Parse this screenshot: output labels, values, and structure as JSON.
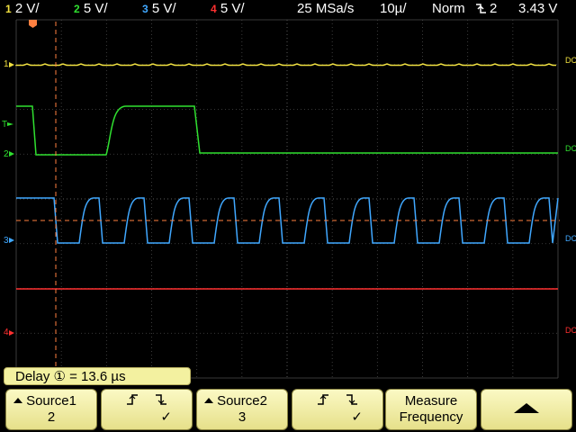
{
  "topbar": {
    "ch1": {
      "num": "1",
      "scale": "2 V/",
      "color": "#f0e040"
    },
    "ch2": {
      "num": "2",
      "scale": "5 V/",
      "color": "#30e030"
    },
    "ch3": {
      "num": "3",
      "scale": "5 V/",
      "color": "#40a8ff"
    },
    "ch4": {
      "num": "4",
      "scale": "5 V/",
      "color": "#ff3030"
    },
    "sample_rate": "25 MSa/s",
    "timebase": "10µ/",
    "trigger_mode": "Norm",
    "trigger_icon": "trigger-falling-edge-icon",
    "trigger_source": "2",
    "trigger_level": "3.43 V"
  },
  "screen": {
    "markers": {
      "ch1": "1",
      "ch2": "2",
      "ch3": "3",
      "ch4": "4",
      "trigger_level_mark": "T",
      "coupling_ch1": "DC",
      "coupling_ch2": "DC",
      "coupling_ch3": "DC",
      "coupling_ch4": "DC"
    },
    "trigger_position_icon": "trigger-position-icon"
  },
  "statusbar": {
    "text": "Delay ① = 13.6 µs"
  },
  "softkeys": [
    {
      "line1": "Source1",
      "line2": "2"
    },
    {
      "line1": "ƒ  ţ",
      "line2": "✓",
      "icon": "rising-falling-edge-icon"
    },
    {
      "line1": "Source2",
      "line2": "3"
    },
    {
      "line1": "ƒ  ţ",
      "line2": "✓",
      "icon": "rising-falling-edge-icon"
    },
    {
      "line1": "Measure",
      "line2": "Frequency"
    },
    {
      "line1": "",
      "line2": "",
      "icon": "up-arrow-icon"
    }
  ],
  "colors": {
    "grid": "#5a5a5a",
    "cursor": "#ff8040",
    "ch1": "#f0e040",
    "ch2": "#30e030",
    "ch3": "#40a8ff",
    "ch4": "#ff3030"
  }
}
